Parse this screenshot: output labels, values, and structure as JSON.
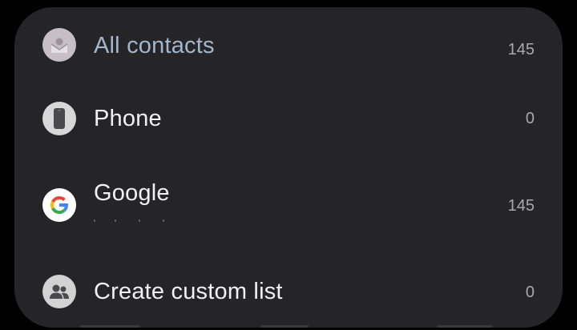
{
  "contact_sources": [
    {
      "label": "All contacts",
      "count": "145",
      "icon": "all-contacts-icon"
    },
    {
      "label": "Phone",
      "count": "0",
      "icon": "phone-device-icon"
    },
    {
      "label": "Google",
      "count": "145",
      "icon": "google-icon"
    },
    {
      "label": "Create custom list",
      "count": "0",
      "icon": "group-people-icon"
    }
  ],
  "colors": {
    "panel": "#252527",
    "highlight_label": "#a3b6cc",
    "text": "#f1f1f1",
    "count": "#a9a9ab"
  }
}
